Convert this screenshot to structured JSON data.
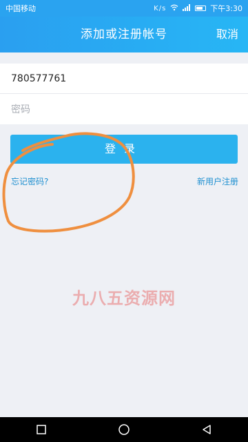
{
  "status_bar": {
    "carrier": "中国移动",
    "speed": "K/s",
    "time": "下午3:30"
  },
  "header": {
    "title": "添加或注册帐号",
    "cancel_label": "取消"
  },
  "form": {
    "account_value": "780577761",
    "password_placeholder": "密码"
  },
  "actions": {
    "login_label": "登录",
    "forgot_label": "忘记密码?",
    "register_label": "新用户注册"
  },
  "watermark": "九八五资源网",
  "colors": {
    "header_blue": "#2aa3f0",
    "button_blue": "#2bb2ee",
    "link_blue": "#1e8fd0",
    "annotation_orange": "#ef8f3f"
  },
  "icons": [
    "wifi-icon",
    "signal-icon",
    "battery-icon",
    "recent-apps-icon",
    "home-icon",
    "back-icon"
  ]
}
